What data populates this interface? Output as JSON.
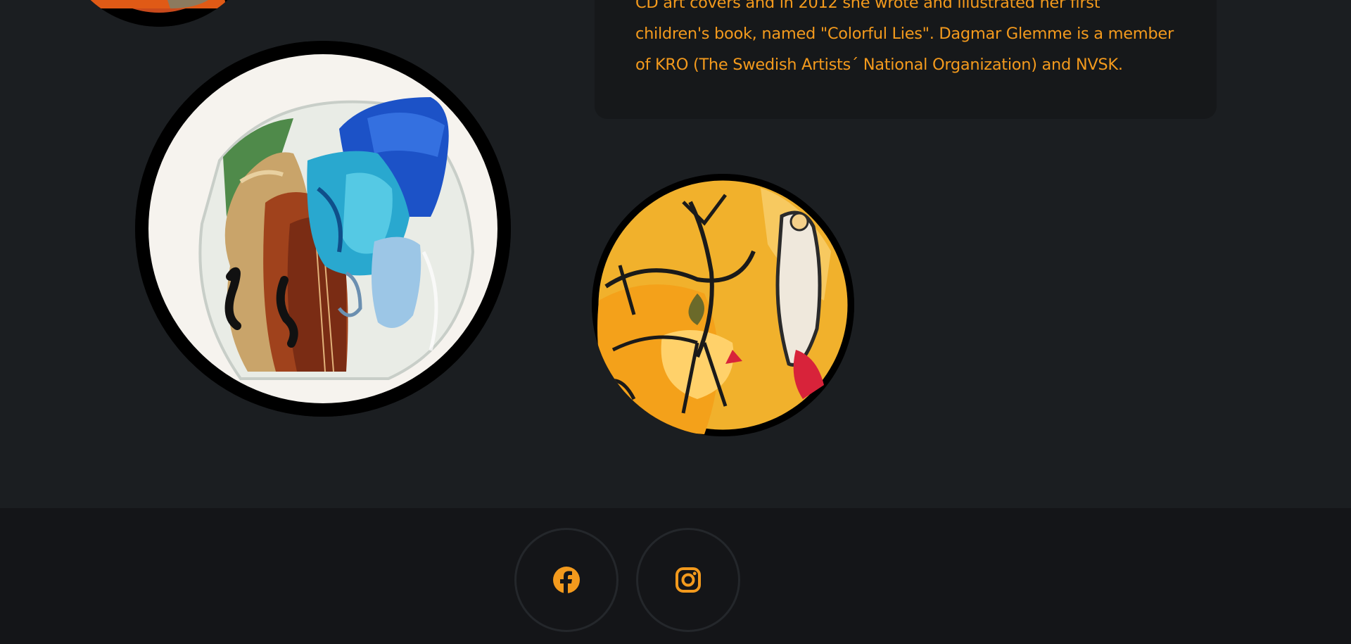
{
  "bio": {
    "lines": [
      "CD art covers and in 2012 she wrote and illustrated her first",
      "children's book, named \"Colorful Lies\". Dagmar Glemme is a member",
      "of KRO (The Swedish Artists´ National Organization) and NVSK."
    ]
  },
  "gallery": {
    "items": [
      {
        "icon": "painting-thumbnail"
      },
      {
        "icon": "glass-sculpture-image"
      },
      {
        "icon": "abstract-painting-image"
      }
    ]
  },
  "footer": {
    "social": [
      {
        "icon": "facebook-icon",
        "color": "#f39a1d"
      },
      {
        "icon": "instagram-icon",
        "color": "#f39a1d"
      }
    ]
  },
  "colors": {
    "accent": "#f39a1d",
    "background": "#1b1e21",
    "footer": "#141518",
    "card": "#16181a"
  }
}
